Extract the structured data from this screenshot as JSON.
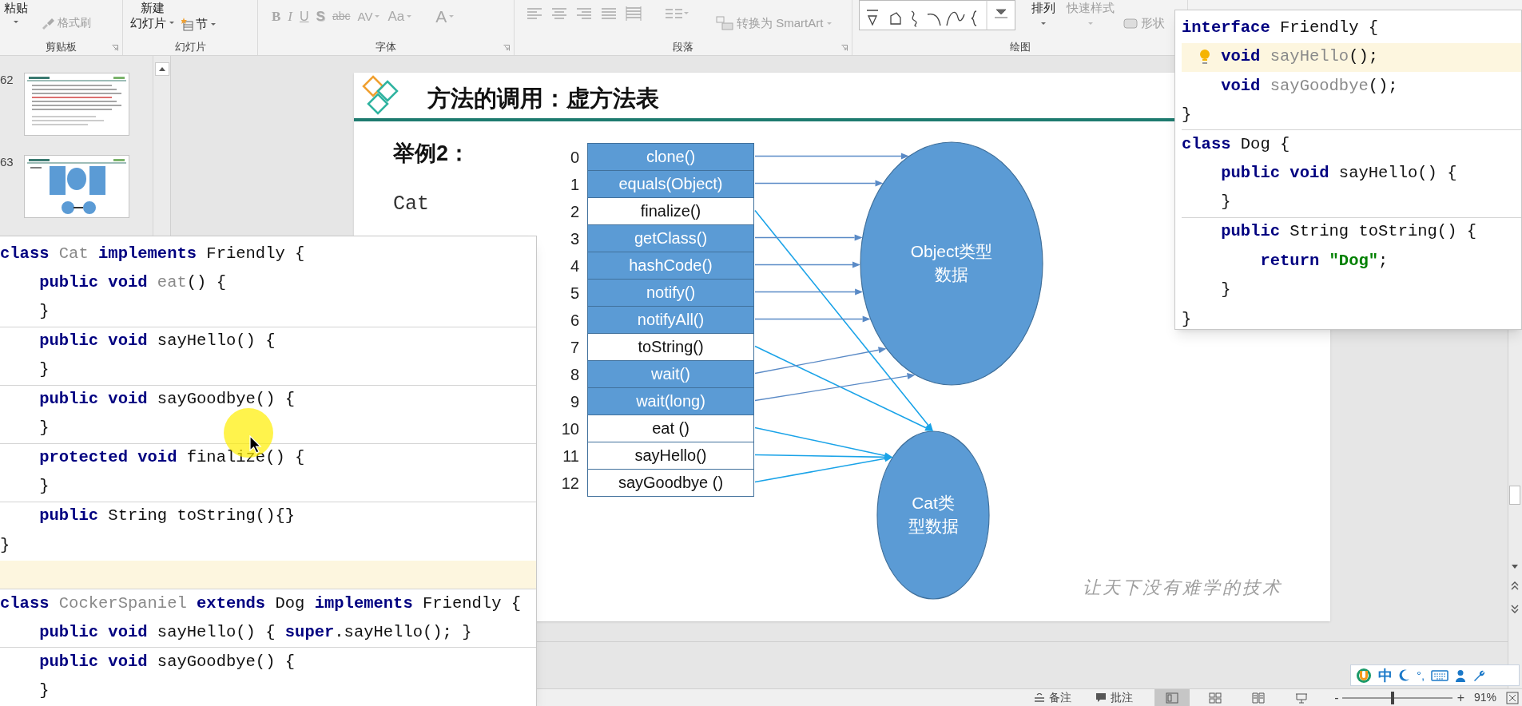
{
  "ribbon": {
    "groups": [
      {
        "kind": "clipboard",
        "label": "剪贴板",
        "launcher": true,
        "paste": "粘贴",
        "format_painter": "格式刷"
      },
      {
        "kind": "slides",
        "label": "幻灯片",
        "launcher": false,
        "new_slide": [
          "新建",
          "幻灯片"
        ],
        "section": "节"
      },
      {
        "kind": "font",
        "label": "字体",
        "launcher": true,
        "buttons": [
          {
            "kind": "bold",
            "label": "B"
          },
          {
            "kind": "italic",
            "label": "I"
          },
          {
            "kind": "underline",
            "label": "U"
          },
          {
            "kind": "shadow",
            "label": "S"
          },
          {
            "kind": "strike",
            "label": "abc"
          },
          {
            "kind": "spacing",
            "label": "AV"
          },
          {
            "kind": "case",
            "label": "Aa"
          },
          {
            "kind": "color",
            "label": "A"
          }
        ]
      },
      {
        "kind": "paragraph",
        "label": "段落",
        "launcher": true,
        "smartart": "转换为 SmartArt"
      },
      {
        "kind": "drawing",
        "label": "绘图",
        "launcher": false,
        "arrange": "排列",
        "quick_styles": "快速样式",
        "shape": "形状"
      }
    ]
  },
  "thumbnails": [
    {
      "number": "62",
      "kind": "text"
    },
    {
      "number": "63",
      "kind": "diagram"
    }
  ],
  "slide": {
    "title": "方法的调用：虚方法表",
    "heading": "举例2：",
    "subtitle": "Cat",
    "methods": [
      {
        "index": "0",
        "label": "clone()",
        "kind": "object"
      },
      {
        "index": "1",
        "label": "equals(Object)",
        "kind": "object"
      },
      {
        "index": "2",
        "label": "finalize()",
        "kind": "cat"
      },
      {
        "index": "3",
        "label": "getClass()",
        "kind": "object"
      },
      {
        "index": "4",
        "label": "hashCode()",
        "kind": "object"
      },
      {
        "index": "5",
        "label": "notify()",
        "kind": "object"
      },
      {
        "index": "6",
        "label": "notifyAll()",
        "kind": "object"
      },
      {
        "index": "7",
        "label": "toString()",
        "kind": "cat"
      },
      {
        "index": "8",
        "label": "wait()",
        "kind": "object"
      },
      {
        "index": "9",
        "label": "wait(long)",
        "kind": "object"
      },
      {
        "index": "10",
        "label": "eat ()",
        "kind": "cat"
      },
      {
        "index": "11",
        "label": "sayHello()",
        "kind": "cat"
      },
      {
        "index": "12",
        "label": "sayGoodbye ()",
        "kind": "cat"
      }
    ],
    "ellipses": [
      {
        "kind": "object",
        "lines": [
          "Object类型",
          "数据"
        ]
      },
      {
        "kind": "cat",
        "lines": [
          "Cat类",
          "型数据"
        ]
      }
    ],
    "slogan": "让天下没有难学的技术"
  },
  "code_left": [
    {
      "tokens": [
        {
          "kind": "keyword",
          "text": "class"
        },
        {
          "kind": "unused",
          "text": " Cat"
        },
        {
          "kind": "keyword",
          "text": " implements"
        },
        {
          "kind": "plain",
          "text": " Friendly {"
        }
      ],
      "highlighted": false,
      "divider_below": false,
      "hint": false
    },
    {
      "tokens": [
        {
          "kind": "keyword",
          "text": "    public void"
        },
        {
          "kind": "unused",
          "text": " eat"
        },
        {
          "kind": "plain",
          "text": "() {"
        }
      ],
      "highlighted": false,
      "divider_below": false,
      "hint": false
    },
    {
      "tokens": [
        {
          "kind": "plain",
          "text": "    }"
        }
      ],
      "highlighted": false,
      "divider_below": true,
      "hint": false
    },
    {
      "tokens": [
        {
          "kind": "keyword",
          "text": "    public void"
        },
        {
          "kind": "plain",
          "text": " sayHello() {"
        }
      ],
      "highlighted": false,
      "divider_below": false,
      "hint": false
    },
    {
      "tokens": [
        {
          "kind": "plain",
          "text": "    }"
        }
      ],
      "highlighted": false,
      "divider_below": true,
      "hint": false
    },
    {
      "tokens": [
        {
          "kind": "keyword",
          "text": "    public void"
        },
        {
          "kind": "plain",
          "text": " sayGoodbye() {"
        }
      ],
      "highlighted": false,
      "divider_below": false,
      "hint": false
    },
    {
      "tokens": [
        {
          "kind": "plain",
          "text": "    }"
        }
      ],
      "highlighted": false,
      "divider_below": true,
      "hint": false
    },
    {
      "tokens": [
        {
          "kind": "keyword",
          "text": "    protected void"
        },
        {
          "kind": "plain",
          "text": " finalize() {"
        }
      ],
      "highlighted": false,
      "divider_below": false,
      "hint": false
    },
    {
      "tokens": [
        {
          "kind": "plain",
          "text": "    }"
        }
      ],
      "highlighted": false,
      "divider_below": true,
      "hint": false
    },
    {
      "tokens": [
        {
          "kind": "keyword",
          "text": "    public"
        },
        {
          "kind": "plain",
          "text": " String toString(){}"
        }
      ],
      "highlighted": false,
      "divider_below": false,
      "hint": false
    },
    {
      "tokens": [
        {
          "kind": "plain",
          "text": "}"
        }
      ],
      "highlighted": false,
      "divider_below": false,
      "hint": false
    },
    {
      "highlighted": true,
      "divider_below": true,
      "hint": false
    },
    {
      "tokens": [
        {
          "kind": "keyword",
          "text": "class"
        },
        {
          "kind": "unused",
          "text": " CockerSpaniel"
        },
        {
          "kind": "keyword",
          "text": " extends"
        },
        {
          "kind": "plain",
          "text": " Dog"
        },
        {
          "kind": "keyword",
          "text": " implements"
        },
        {
          "kind": "plain",
          "text": " Friendly {"
        }
      ],
      "highlighted": false,
      "divider_below": false,
      "hint": false
    },
    {
      "tokens": [
        {
          "kind": "keyword",
          "text": "    public void"
        },
        {
          "kind": "plain",
          "text": " sayHello() {"
        },
        {
          "kind": "keyword",
          "text": " super"
        },
        {
          "kind": "plain",
          "text": ".sayHello(); }"
        }
      ],
      "highlighted": false,
      "divider_below": true,
      "hint": false
    },
    {
      "tokens": [
        {
          "kind": "keyword",
          "text": "    public void"
        },
        {
          "kind": "plain",
          "text": " sayGoodbye() {"
        }
      ],
      "highlighted": false,
      "divider_below": false,
      "hint": false
    },
    {
      "tokens": [
        {
          "kind": "plain",
          "text": "    }"
        }
      ],
      "highlighted": false,
      "divider_below": false,
      "hint": false
    }
  ],
  "code_right": [
    {
      "tokens": [
        {
          "kind": "keyword",
          "text": "interface"
        },
        {
          "kind": "plain",
          "text": " Friendly {"
        }
      ],
      "highlighted": false,
      "divider_below": false,
      "hint": false
    },
    {
      "tokens": [
        {
          "kind": "keyword",
          "text": "    void"
        },
        {
          "kind": "unused",
          "text": " sayHello"
        },
        {
          "kind": "plain",
          "text": "();"
        }
      ],
      "highlighted": true,
      "divider_below": false,
      "hint": true
    },
    {
      "tokens": [
        {
          "kind": "keyword",
          "text": "    void"
        },
        {
          "kind": "unused",
          "text": " sayGoodbye"
        },
        {
          "kind": "plain",
          "text": "();"
        }
      ],
      "highlighted": false,
      "divider_below": false,
      "hint": false
    },
    {
      "tokens": [
        {
          "kind": "plain",
          "text": "}"
        }
      ],
      "highlighted": false,
      "divider_below": true,
      "hint": false
    },
    {
      "tokens": [
        {
          "kind": "keyword",
          "text": "class"
        },
        {
          "kind": "plain",
          "text": " Dog {"
        }
      ],
      "highlighted": false,
      "divider_below": false,
      "hint": false
    },
    {
      "tokens": [
        {
          "kind": "keyword",
          "text": "    public void"
        },
        {
          "kind": "plain",
          "text": " sayHello() {"
        }
      ],
      "highlighted": false,
      "divider_below": false,
      "hint": false
    },
    {
      "tokens": [
        {
          "kind": "plain",
          "text": "    }"
        }
      ],
      "highlighted": false,
      "divider_below": true,
      "hint": false
    },
    {
      "tokens": [
        {
          "kind": "keyword",
          "text": "    public"
        },
        {
          "kind": "plain",
          "text": " String toString() {"
        }
      ],
      "highlighted": false,
      "divider_below": false,
      "hint": false
    },
    {
      "tokens": [
        {
          "kind": "keyword",
          "text": "        return"
        },
        {
          "kind": "string",
          "text": " \"Dog\""
        },
        {
          "kind": "plain",
          "text": ";"
        }
      ],
      "highlighted": false,
      "divider_below": false,
      "hint": false
    },
    {
      "tokens": [
        {
          "kind": "plain",
          "text": "    }"
        }
      ],
      "highlighted": false,
      "divider_below": false,
      "hint": false
    },
    {
      "tokens": [
        {
          "kind": "plain",
          "text": "}"
        }
      ],
      "highlighted": false,
      "divider_below": false,
      "hint": false
    }
  ],
  "status_bar": {
    "notes": "备注",
    "comments": "批注",
    "views": [
      {
        "kind": "normal",
        "selected": true
      },
      {
        "kind": "sorter",
        "selected": false
      },
      {
        "kind": "reading",
        "selected": false
      },
      {
        "kind": "slideshow",
        "selected": false
      }
    ],
    "zoom_out": "-",
    "zoom": {
      "level": 0.46
    },
    "zoom_in": "+",
    "zoom_percent": "91%"
  },
  "ime_bar": {
    "mode": "中",
    "punctuation": "°,"
  }
}
